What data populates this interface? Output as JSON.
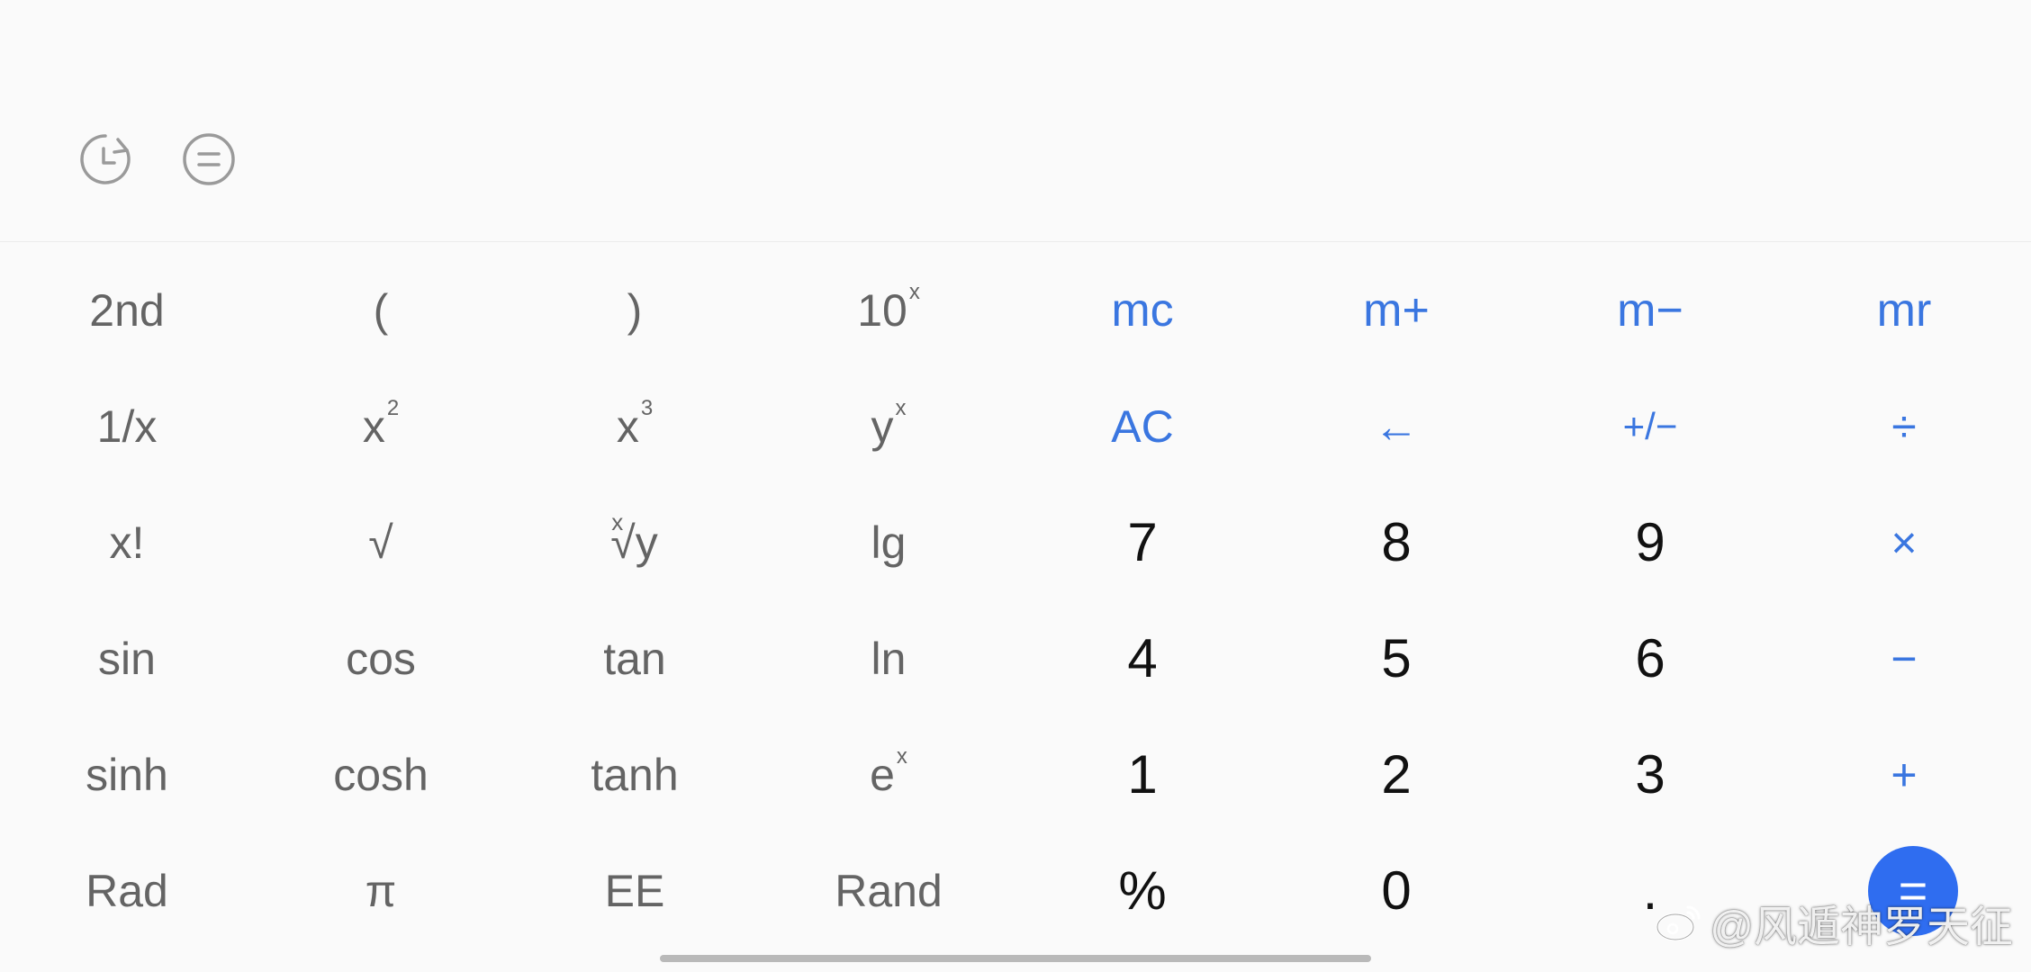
{
  "colors": {
    "background": "#fafafa",
    "scientific_text": "#646464",
    "accent": "#3a76e0",
    "number_text": "#111111",
    "equals_button": "#2f6df0"
  },
  "toolbar": {
    "history_icon": "history-clock-icon",
    "menu_icon": "menu-lines-icon"
  },
  "keys": {
    "row1": {
      "second": "2nd",
      "paren_open": "(",
      "paren_close": ")",
      "ten_pow_base": "10",
      "ten_pow_exp": "x",
      "mc": "mc",
      "m_plus": "m+",
      "m_minus": "m−",
      "mr": "mr"
    },
    "row2": {
      "reciprocal": "1/x",
      "square_base": "x",
      "square_exp": "2",
      "cube_base": "x",
      "cube_exp": "3",
      "power_base": "y",
      "power_exp": "x",
      "ac": "AC",
      "backspace": "←",
      "sign": "+/−",
      "divide": "÷"
    },
    "row3": {
      "factorial": "x!",
      "sqrt": "√",
      "root_index": "x",
      "root_symbol": "√y",
      "lg": "lg",
      "seven": "7",
      "eight": "8",
      "nine": "9",
      "multiply": "×"
    },
    "row4": {
      "sin": "sin",
      "cos": "cos",
      "tan": "tan",
      "ln": "ln",
      "four": "4",
      "five": "5",
      "six": "6",
      "minus": "−"
    },
    "row5": {
      "sinh": "sinh",
      "cosh": "cosh",
      "tanh": "tanh",
      "exp_base": "e",
      "exp_exp": "x",
      "one": "1",
      "two": "2",
      "three": "3",
      "plus": "+"
    },
    "row6": {
      "rad": "Rad",
      "pi": "π",
      "ee": "EE",
      "rand": "Rand",
      "percent": "%",
      "zero": "0",
      "decimal": ".",
      "equals": "="
    }
  },
  "watermark": {
    "text": "@风遁神罗天征"
  }
}
